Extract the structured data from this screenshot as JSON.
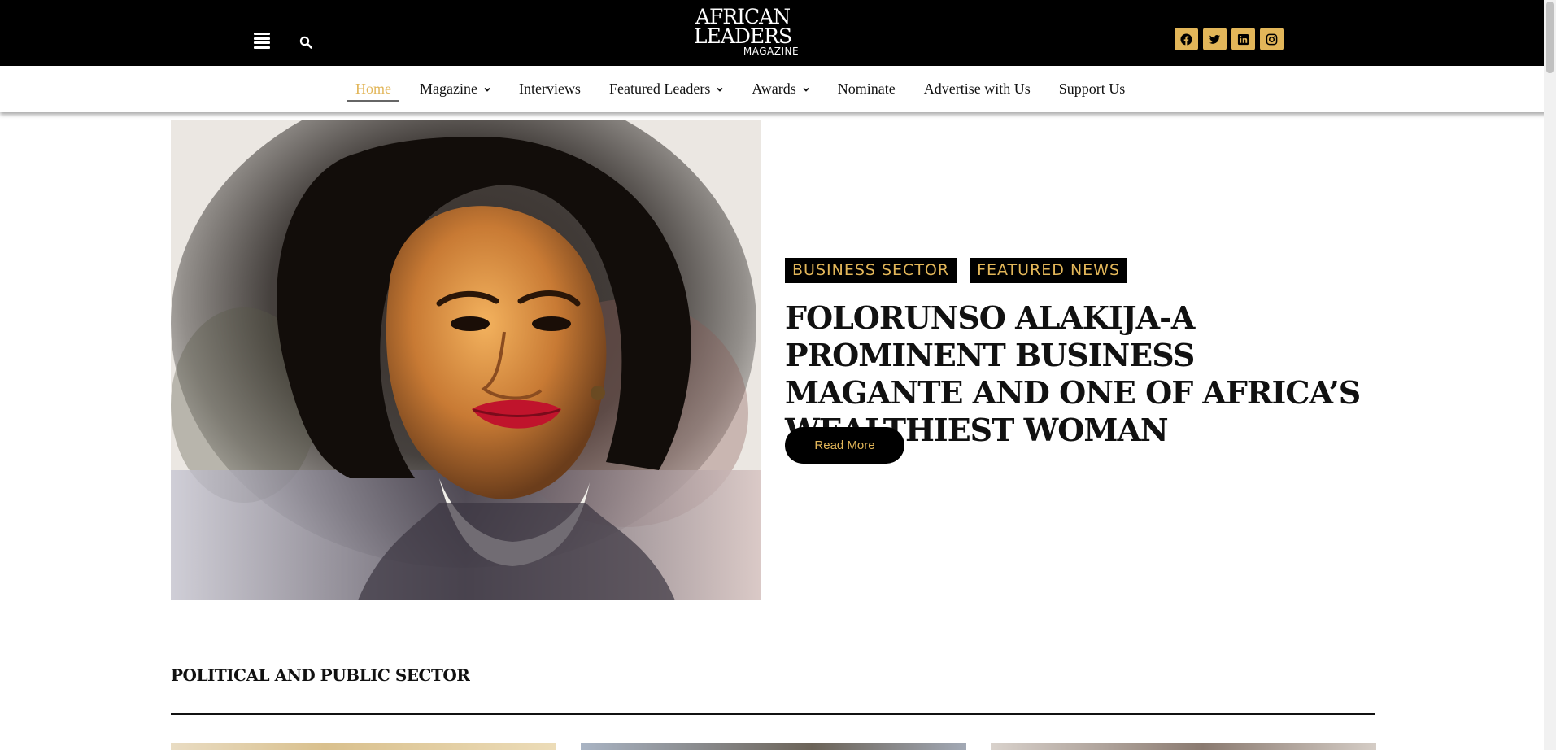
{
  "header": {
    "logo_line1": "AFRICAN",
    "logo_line2": "LEADERS",
    "logo_line3": "MAGAZINE",
    "social": [
      "facebook-icon",
      "twitter-icon",
      "linkedin-icon",
      "instagram-icon"
    ]
  },
  "nav": {
    "items": [
      {
        "label": "Home",
        "active": true,
        "dropdown": false
      },
      {
        "label": "Magazine",
        "active": false,
        "dropdown": true
      },
      {
        "label": "Interviews",
        "active": false,
        "dropdown": false
      },
      {
        "label": "Featured Leaders",
        "active": false,
        "dropdown": true
      },
      {
        "label": "Awards",
        "active": false,
        "dropdown": true
      },
      {
        "label": "Nominate",
        "active": false,
        "dropdown": false
      },
      {
        "label": "Advertise with Us",
        "active": false,
        "dropdown": false
      },
      {
        "label": "Support Us",
        "active": false,
        "dropdown": false
      }
    ]
  },
  "hero": {
    "tags": [
      "BUSINESS SECTOR",
      "FEATURED NEWS"
    ],
    "title": "FOLORUNSO ALAKIJA-A PROMINENT BUSINESS MAGANTE AND ONE OF AFRICA’S WEALTHIEST WOMAN",
    "read_more": "Read More"
  },
  "section": {
    "title": "POLITICAL AND PUBLIC SECTOR"
  },
  "colors": {
    "accent": "#e2b659",
    "topbar": "#000000"
  }
}
